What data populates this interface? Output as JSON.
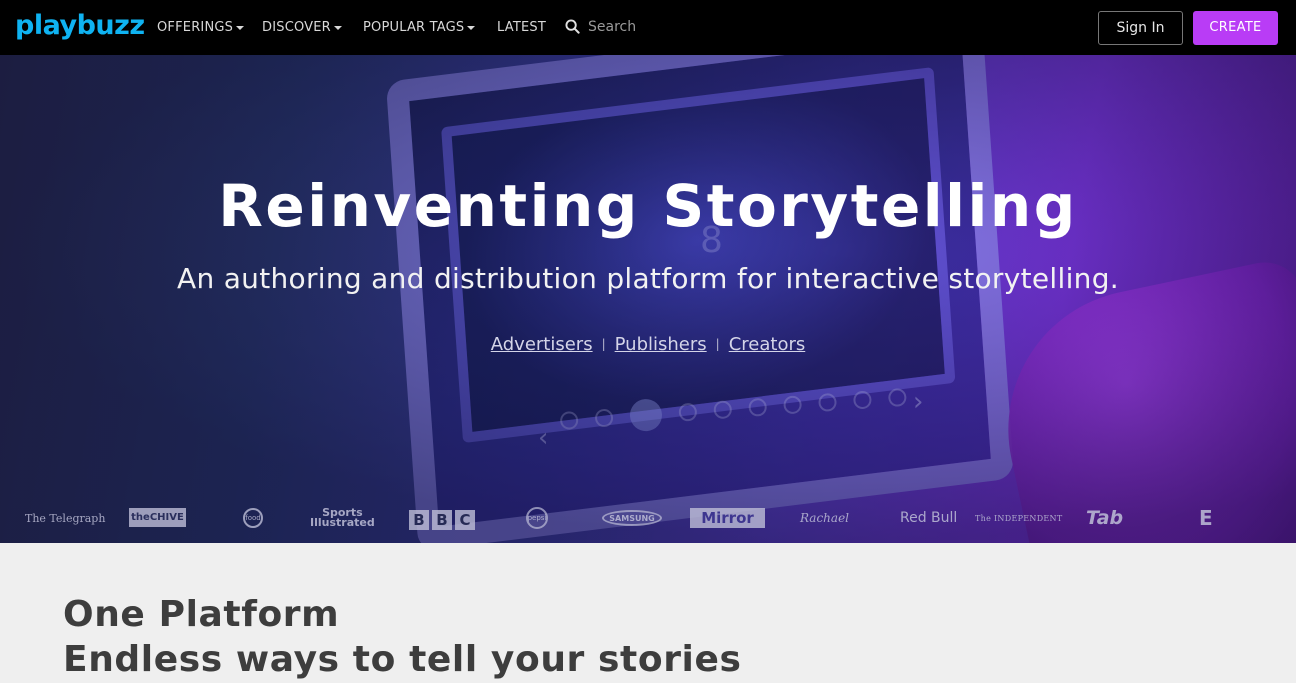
{
  "nav": {
    "logo": "playbuzz",
    "items": [
      {
        "label": "OFFERINGS",
        "dropdown": true
      },
      {
        "label": "DISCOVER",
        "dropdown": true
      },
      {
        "label": "POPULAR TAGS",
        "dropdown": true
      },
      {
        "label": "LATEST",
        "dropdown": false
      }
    ],
    "search_placeholder": "Search",
    "signin_label": "Sign In",
    "create_label": "CREATE"
  },
  "hero": {
    "title": "Reinventing Storytelling",
    "subtitle": "An authoring and distribution platform for interactive storytelling.",
    "links": [
      "Advertisers",
      "Publishers",
      "Creators"
    ],
    "separator": "|",
    "slide_number": "8",
    "logos": {
      "telegraph": "The Telegraph",
      "chive": "theCHIVE",
      "food": "food",
      "si": [
        "Sports",
        "Illustrated"
      ],
      "bbc": [
        "B",
        "B",
        "C"
      ],
      "pepsi": "pepsi",
      "samsung": "SAMSUNG",
      "mirror": "Mirror",
      "rachael": "Rachael",
      "redbull": "Red Bull",
      "independent": "The INDEPENDENT",
      "tab": "Tab",
      "e": "E"
    }
  },
  "section": {
    "title": "One Platform",
    "subtitle": "Endless ways to tell your stories"
  },
  "colors": {
    "nav_bg": "#000000",
    "create_bg": "#b93cf6",
    "logo": "#0fb3f2",
    "section_bg": "#efefef",
    "heading": "#3d3d3d"
  }
}
